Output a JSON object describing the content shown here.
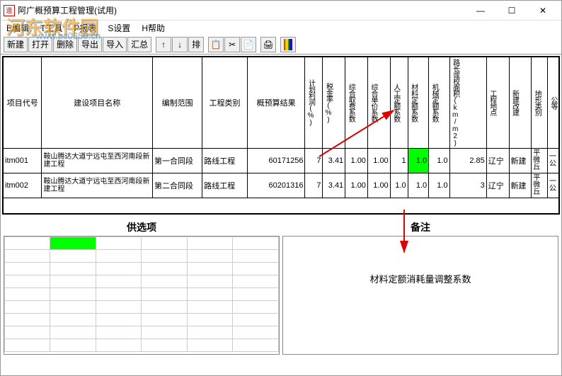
{
  "window": {
    "title": "阿广概预算工程管理(试用)",
    "min": "—",
    "max": "☐",
    "close": "✕"
  },
  "menu": [
    "E编辑",
    "T工具",
    "P报表",
    "S设置",
    "H帮助"
  ],
  "toolbar": {
    "new": "新建",
    "open": "打开",
    "delete": "删除",
    "export": "导出",
    "import": "导入",
    "summary": "汇总",
    "up": "↑",
    "down": "↓",
    "sort": "排",
    "copy": "📋",
    "cut": "✂",
    "paste": "📄",
    "print": "🖨"
  },
  "headers": [
    "项目代号",
    "建设项目名称",
    "编制范围",
    "工程类别",
    "概预算结果",
    "计划利润(%)",
    "税金率(%)",
    "综合取费系数",
    "综合单价系数",
    "人工定额系数",
    "材料定额系数",
    "机械定额系数",
    "路长或校面积(km/m2)",
    "工程地点",
    "新建改建",
    "地形类别",
    "公等"
  ],
  "rows": [
    {
      "code": "itm001",
      "name": "鞍山腾达大道宁远屯至西河南段新建工程",
      "scope": "第一合同段",
      "type": "路线工程",
      "result": "60171256",
      "profit": "7",
      "tax": "3.41",
      "comp1": "1.00",
      "comp2": "1.00",
      "labor": "1",
      "mat": "1.0",
      "mach": "1.0",
      "len": "2.85",
      "loc": "辽宁",
      "build": "新建",
      "terrain": "平微丘",
      "road": "一公"
    },
    {
      "code": "itm002",
      "name": "鞍山腾达大道宁远屯至西河南段新建工程",
      "scope": "第二合同段",
      "type": "路线工程",
      "result": "60201316",
      "profit": "7",
      "tax": "3.41",
      "comp1": "1.00",
      "comp2": "1.00",
      "labor": "1.0",
      "mat": "1.0",
      "mach": "1.0",
      "len": "3",
      "loc": "辽宁",
      "build": "新建",
      "terrain": "平微丘",
      "road": "一公"
    }
  ],
  "panels": {
    "options": "供选项",
    "notes": "备注"
  },
  "noteText": "材料定额消耗量调整系数",
  "watermark": {
    "main": "河东软件园",
    "url": "www.pc0359.cn"
  }
}
